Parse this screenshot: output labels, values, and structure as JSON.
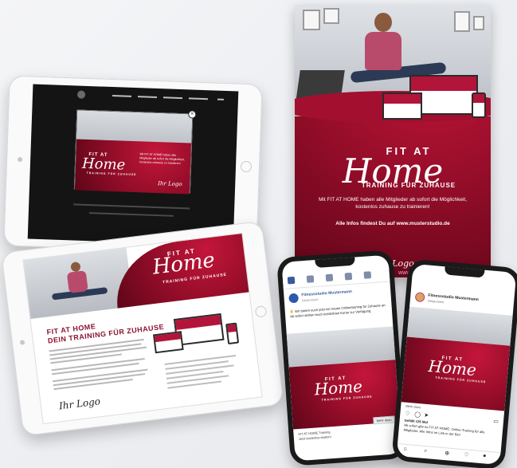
{
  "brand": {
    "fit_at": "FIT AT",
    "home": "Home",
    "subtitle": "TRAINING FÜR ZUHAUSE",
    "logo": "Ihr Logo"
  },
  "poster": {
    "body": "Mit FIT AT HOME haben alle Mitglieder ab sofort die Möglichkeit, kostenlos zuhause zu trainieren!",
    "info": "Alle Infos findest Du auf www.musterstudio.de",
    "url": "WWW.MUSTERSTUDIO.DE"
  },
  "tablet1": {
    "close": "×",
    "popup_text": "Mit FIT AT HOME haben alle Mitglieder ab sofort die Möglichkeit, kostenlos zuhause zu trainieren!"
  },
  "tablet2": {
    "heading1": "FIT AT HOME",
    "heading2": "DEIN TRAINING FÜR ZUHAUSE"
  },
  "facebook": {
    "page_name": "Fitnessstudio Mustermann",
    "page_sub": "Gesponsert",
    "post_text": "✌ Wir bieten euch jetzt ein neues Onlinetraining für Zuhause an. Ab sofort stehen euch kostenlose Kurse zur Verfügung.",
    "footer_line1": "FIT AT HOME Training",
    "footer_line2": "Jetzt kostenlos starten!",
    "button": "Mehr dazu"
  },
  "instagram": {
    "account": "Fitnessstudio Mustermann",
    "sub": "Gesponsert",
    "more": "Mehr dazu",
    "likes": "Gefällt 125 Mal",
    "caption": "Ab sofort gibt es FIT AT HOME: Online-Training für alle Mitglieder. Alle Infos im Link in der Bio!"
  },
  "colors": {
    "brand_red": "#a3102f",
    "dark_red": "#5e0618",
    "heading_red": "#8a1130",
    "facebook_blue": "#385898"
  },
  "icons": [
    "close-icon",
    "home-icon",
    "search-icon",
    "heart-icon",
    "comment-icon",
    "share-icon",
    "bookmark-icon",
    "profile-icon",
    "menu-icon"
  ]
}
